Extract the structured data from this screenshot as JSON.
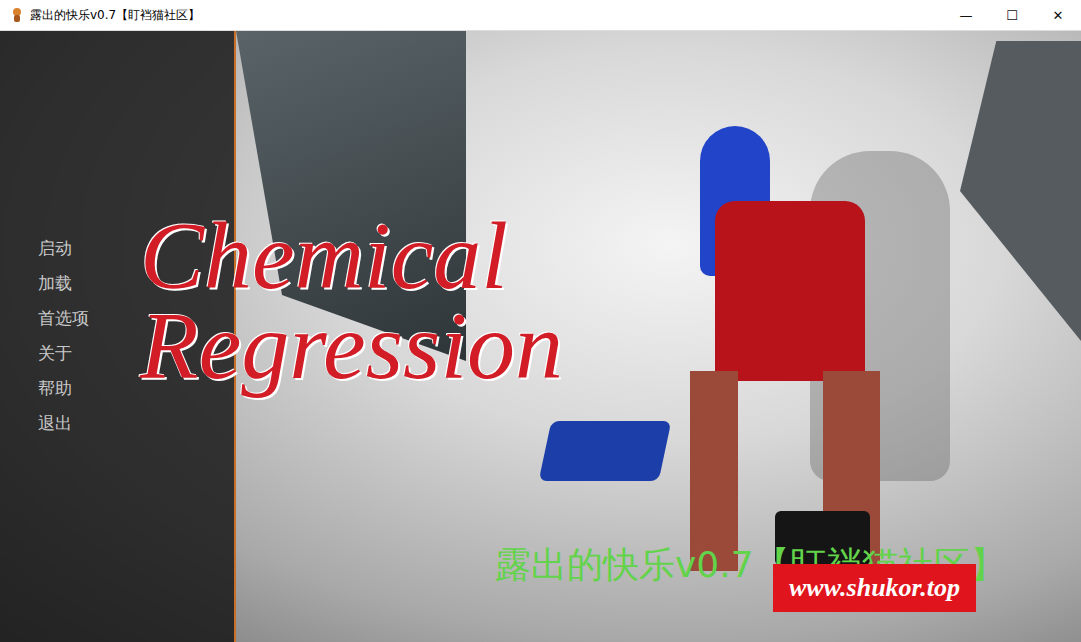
{
  "window": {
    "title": "露出的快乐v0.7【盯裆猫社区】",
    "controls": [
      "—",
      "☐",
      "✕"
    ]
  },
  "menu": {
    "items": [
      {
        "label": "启动",
        "selected": false
      },
      {
        "label": "加载",
        "selected": false
      },
      {
        "label": "首选项",
        "selected": false
      },
      {
        "label": "关于",
        "selected": false
      },
      {
        "label": "帮助",
        "selected": false
      },
      {
        "label": "退出",
        "selected": false
      }
    ]
  },
  "logo": {
    "title": "Chemical Regression"
  },
  "overlay": {
    "caption": "露出的快乐v0.7【盯裆猫社区】",
    "watermark": "www.shukor.top"
  }
}
